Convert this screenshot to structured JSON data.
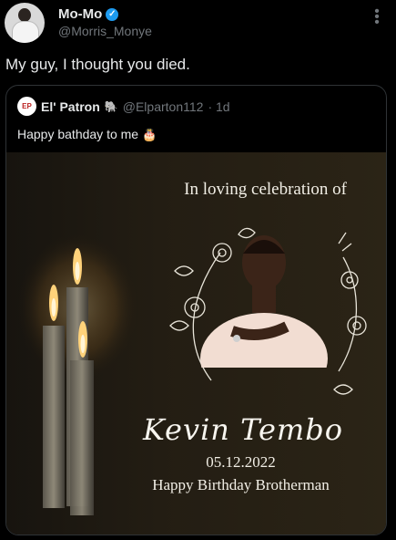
{
  "tweet": {
    "author_name": "Mo-Mo",
    "author_handle": "@Morris_Monye",
    "text": "My guy, I thought you died.",
    "more_icon": "⋮"
  },
  "quote": {
    "avatar_text": "EP",
    "author_name": "El' Patron",
    "author_handle": "@Elparton112",
    "time": "· 1d",
    "text": "Happy bathday to me",
    "cake_emoji": "🎂"
  },
  "poster": {
    "title": "In loving celebration of",
    "name": "Kevin Tembo",
    "date": "05.12.2022",
    "message": "Happy Birthday Brotherman"
  },
  "colors": {
    "verified": "#1d9bf0",
    "background": "#000000",
    "muted": "#71767b"
  }
}
